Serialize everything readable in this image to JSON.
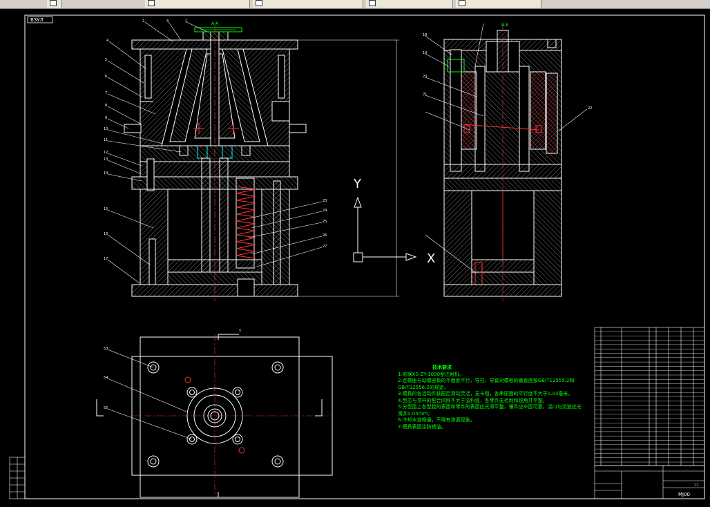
{
  "tabs": [
    {
      "label": "",
      "icon": "document-icon"
    },
    {
      "label": "",
      "icon": "document-icon"
    },
    {
      "label": "",
      "icon": "document-icon"
    },
    {
      "label": "",
      "icon": "document-icon"
    },
    {
      "label": "",
      "icon": "document-icon"
    }
  ],
  "view_label": "ВЗУЛ",
  "section_labels": {
    "aa": "A-A",
    "bb": "B-B",
    "b_mark": "B"
  },
  "axes": {
    "y": "Y",
    "x": "X"
  },
  "balloons_left": [
    "1",
    "2",
    "3",
    "4",
    "5",
    "6",
    "7",
    "8",
    "9",
    "10",
    "11",
    "12",
    "13",
    "14",
    "15",
    "16",
    "17"
  ],
  "balloons_right_sec": [
    "18",
    "19",
    "20",
    "21",
    "22"
  ],
  "balloons_mid": [
    "23",
    "24",
    "25",
    "26",
    "27"
  ],
  "balloons_plan": [
    "53",
    "54",
    "55"
  ],
  "tech_notes": {
    "title": "技术要求",
    "items": [
      "1.依据XS-ZY-1000型注射机。",
      "2.定模座与动模座板的平面度平行，导柱、导套对模板的垂直度按GB/T12555.2和GB/T12556.2的规定。",
      "3.模具的各活动件装配后滑动灵活，无卡阻，各承压面的平行度不大于0.03毫米。",
      "4.型芯与顶杆的配合间隙不大于溢料值，各零件无毛刺和锐角并平整。",
      "5.分型面上各型腔的表面和零件的表面应光滑平整，镶件应牢固可靠，浇口与流道应光滑并0.05mm。",
      "6.冷却水道畅通，不得有渗漏现象。",
      "7.模具表面涂防锈油。"
    ]
  },
  "title_block": {
    "drawing_no": "MJ00",
    "scale": "1:1"
  },
  "colors": {
    "outline": "#ffffff",
    "hatch": "#ff3333",
    "center": "#ff3333",
    "green": "#00ff00",
    "cyan": "#00ffff",
    "tab": "#ece9d8"
  }
}
